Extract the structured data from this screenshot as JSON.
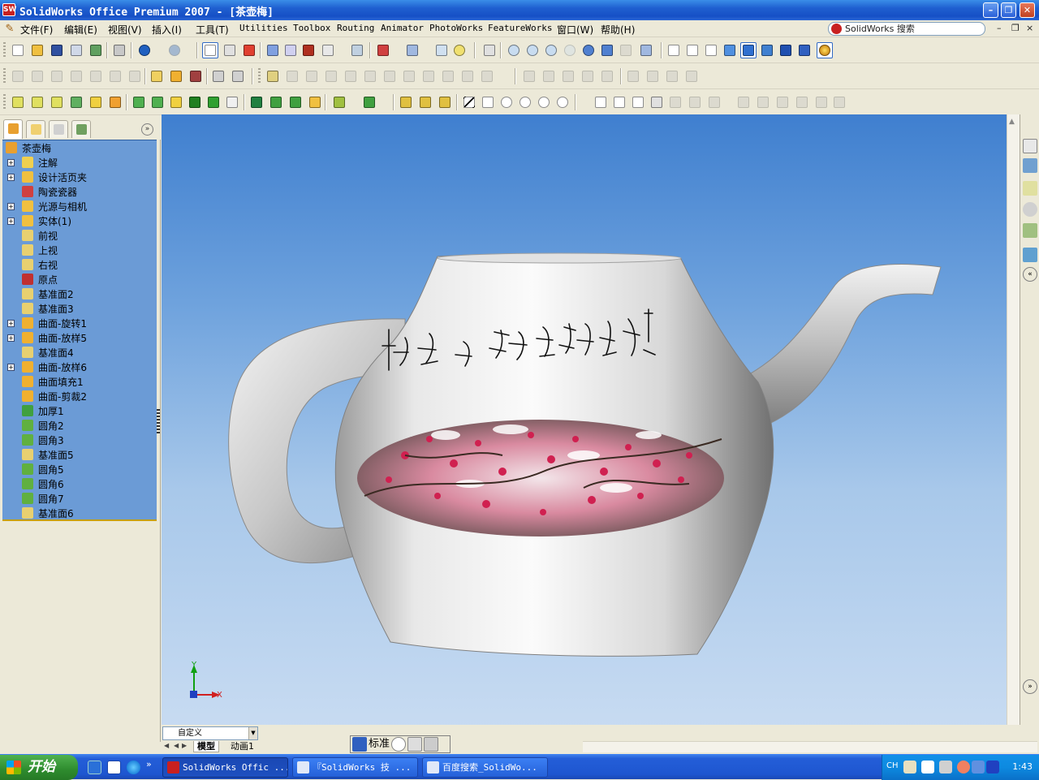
{
  "window": {
    "title": "SolidWorks Office Premium 2007 - [茶壶梅]",
    "icon": "solidworks-logo",
    "controls": [
      "minimize",
      "restore",
      "close"
    ]
  },
  "menubar": {
    "items": [
      "文件(F)",
      "编辑(E)",
      "视图(V)",
      "插入(I)",
      "工具(T)",
      "Utilities",
      "Toolbox",
      "Routing",
      "Animator",
      "PhotoWorks",
      "FeatureWorks",
      "窗口(W)",
      "帮助(H)"
    ],
    "search_label": "SolidWorks 搜索",
    "doc_controls": [
      "–",
      "❐",
      "×"
    ]
  },
  "feature_manager": {
    "tabs": [
      "featuremanager-tab",
      "propertymanager-tab",
      "configurationmanager-tab",
      "dimxpert-tab"
    ],
    "root": "茶壶梅",
    "items": [
      {
        "label": "注解",
        "icon": "annotation-icon",
        "expandable": true
      },
      {
        "label": "设计活页夹",
        "icon": "design-binder-icon",
        "expandable": true
      },
      {
        "label": "陶瓷瓷器",
        "icon": "material-icon",
        "expandable": false
      },
      {
        "label": "光源与相机",
        "icon": "lights-camera-icon",
        "expandable": true
      },
      {
        "label": "实体(1)",
        "icon": "solid-bodies-icon",
        "expandable": true
      },
      {
        "label": "前视",
        "icon": "plane-icon",
        "expandable": false
      },
      {
        "label": "上视",
        "icon": "plane-icon",
        "expandable": false
      },
      {
        "label": "右视",
        "icon": "plane-icon",
        "expandable": false
      },
      {
        "label": "原点",
        "icon": "origin-icon",
        "expandable": false
      },
      {
        "label": "基准面2",
        "icon": "plane-icon",
        "expandable": false
      },
      {
        "label": "基准面3",
        "icon": "plane-icon",
        "expandable": false
      },
      {
        "label": "曲面-旋转1",
        "icon": "surface-revolve-icon",
        "expandable": true
      },
      {
        "label": "曲面-放样5",
        "icon": "surface-loft-icon",
        "expandable": true
      },
      {
        "label": "基准面4",
        "icon": "plane-icon",
        "expandable": false
      },
      {
        "label": "曲面-放样6",
        "icon": "surface-loft-icon",
        "expandable": true
      },
      {
        "label": "曲面填充1",
        "icon": "surface-fill-icon",
        "expandable": false
      },
      {
        "label": "曲面-剪裁2",
        "icon": "surface-trim-icon",
        "expandable": false
      },
      {
        "label": "加厚1",
        "icon": "thicken-icon",
        "expandable": false
      },
      {
        "label": "圆角2",
        "icon": "fillet-icon",
        "expandable": false
      },
      {
        "label": "圆角3",
        "icon": "fillet-icon",
        "expandable": false
      },
      {
        "label": "基准面5",
        "icon": "plane-icon",
        "expandable": false
      },
      {
        "label": "圆角5",
        "icon": "fillet-icon",
        "expandable": false
      },
      {
        "label": "圆角6",
        "icon": "fillet-icon",
        "expandable": false
      },
      {
        "label": "圆角7",
        "icon": "fillet-icon",
        "expandable": false
      },
      {
        "label": "基准面6",
        "icon": "plane-icon",
        "expandable": false
      }
    ]
  },
  "viewport": {
    "model": "teapot-with-calligraphy-and-plum-blossom-decal",
    "triad": {
      "x": "X",
      "y": "Y"
    }
  },
  "bottom": {
    "configuration": "自定义",
    "tabs": [
      "模型",
      "动画1"
    ],
    "ime": {
      "mode": "标准"
    }
  },
  "taskbar": {
    "start": "开始",
    "buttons": [
      {
        "label": "SolidWorks Offic ...",
        "active": true
      },
      {
        "label": "『SolidWorks 技 ...",
        "active": false
      },
      {
        "label": "百度搜索_SolidWo...",
        "active": false
      }
    ],
    "tray": {
      "lang": "CH",
      "clock": "1:43"
    }
  }
}
